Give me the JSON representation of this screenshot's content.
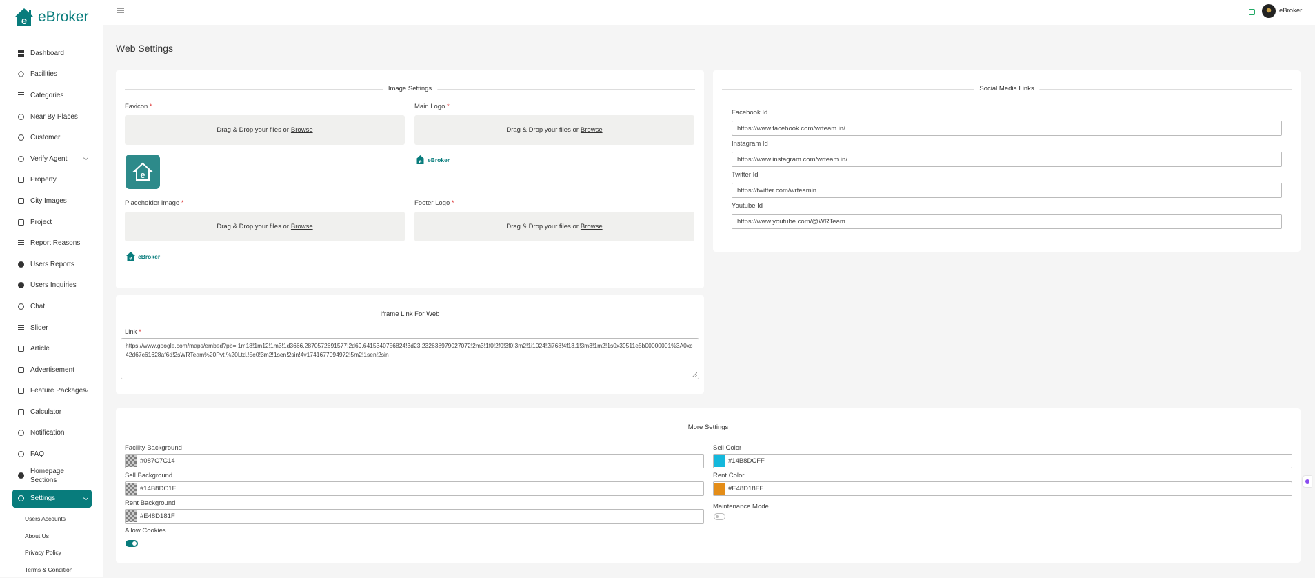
{
  "brand": {
    "name": "eBroker"
  },
  "sidebar": {
    "items": [
      {
        "label": "Dashboard"
      },
      {
        "label": "Facilities"
      },
      {
        "label": "Categories"
      },
      {
        "label": "Near By Places"
      },
      {
        "label": "Customer"
      },
      {
        "label": "Verify Agent"
      },
      {
        "label": "Property"
      },
      {
        "label": "City Images"
      },
      {
        "label": "Project"
      },
      {
        "label": "Report Reasons"
      },
      {
        "label": "Users Reports"
      },
      {
        "label": "Users Inquiries"
      },
      {
        "label": "Chat"
      },
      {
        "label": "Slider"
      },
      {
        "label": "Article"
      },
      {
        "label": "Advertisement"
      },
      {
        "label": "Feature Packages"
      },
      {
        "label": "Calculator"
      },
      {
        "label": "Notification"
      },
      {
        "label": "FAQ"
      },
      {
        "label": "Homepage Sections"
      },
      {
        "label": "Settings"
      }
    ],
    "sub_items": [
      {
        "label": "Users Accounts"
      },
      {
        "label": "About Us"
      },
      {
        "label": "Privacy Policy"
      },
      {
        "label": "Terms & Condition"
      }
    ]
  },
  "header": {
    "username": "eBroker"
  },
  "page": {
    "title": "Web Settings"
  },
  "image_settings": {
    "legend": "Image Settings",
    "required_mark": "*",
    "favicon_label": "Favicon",
    "main_logo_label": "Main Logo",
    "placeholder_label": "Placeholder Image",
    "footer_logo_label": "Footer Logo",
    "drop_text": "Drag & Drop your files or",
    "browse_text": "Browse",
    "logo_text": "eBroker"
  },
  "social": {
    "legend": "Social Media Links",
    "facebook_label": "Facebook Id",
    "facebook_value": "https://www.facebook.com/wrteam.in/",
    "instagram_label": "Instagram Id",
    "instagram_value": "https://www.instagram.com/wrteam.in/",
    "twitter_label": "Twitter Id",
    "twitter_value": "https://twitter.com/wrteamin",
    "youtube_label": "Youtube Id",
    "youtube_value": "https://www.youtube.com/@WRTeam"
  },
  "iframe": {
    "legend": "Iframe Link For Web",
    "link_label": "Link",
    "link_value": "https://www.google.com/maps/embed?pb=!1m18!1m12!1m3!1d3666.2870572691577!2d69.6415340756824!3d23.232638979027072!2m3!1f0!2f0!3f0!3m2!1i1024!2i768!4f13.1!3m3!1m2!1s0x39511e5b00000001%3A0xc42d67c61628af6d!2sWRTeam%20Pvt.%20Ltd.!5e0!3m2!1sen!2sin!4v1741677094972!5m2!1sen!2sin"
  },
  "more": {
    "legend": "More Settings",
    "facility_bg_label": "Facility Background",
    "facility_bg_value": "#087C7C14",
    "sell_bg_label": "Sell Background",
    "sell_bg_value": "#14B8DC1F",
    "rent_bg_label": "Rent Background",
    "rent_bg_value": "#E48D181F",
    "sell_color_label": "Sell Color",
    "sell_color_value": "#14B8DCFF",
    "rent_color_label": "Rent Color",
    "rent_color_value": "#E48D18FF",
    "maintenance_label": "Maintenance Mode",
    "maintenance_on": false,
    "cookies_label": "Allow Cookies",
    "cookies_on": true
  },
  "colors": {
    "brand": "#087c7c",
    "sell_color": "#14B8DC",
    "rent_color": "#E48D18"
  }
}
